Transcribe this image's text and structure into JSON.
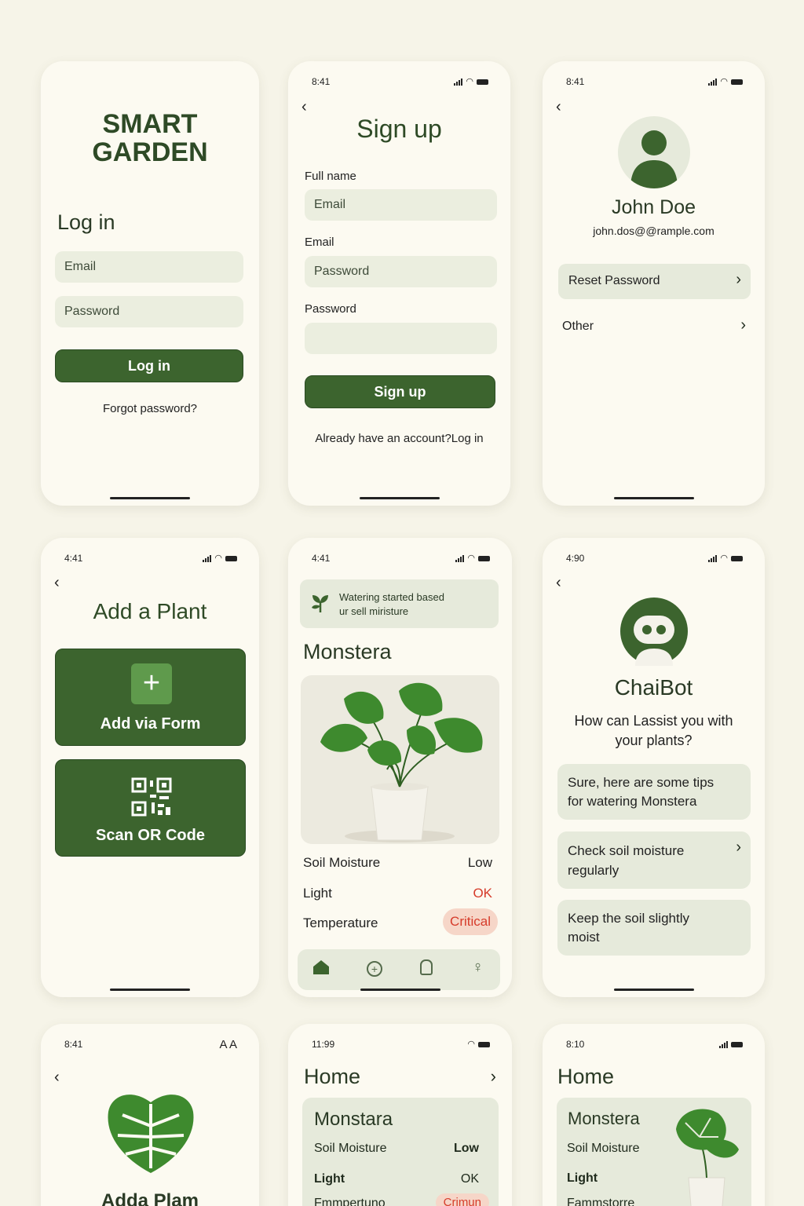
{
  "status_bar": {
    "time_1": "8:41",
    "time_2": "8:41",
    "time_3": "4:41",
    "time_4": "4:41",
    "time_5": "4:90",
    "time_6": "8:41",
    "time_7": "11:99",
    "time_8": "8:10",
    "text_size": "A A"
  },
  "login": {
    "brand_line1": "SMART",
    "brand_line2": "GARDEN",
    "title": "Log in",
    "email_placeholder": "Email",
    "password_placeholder": "Password",
    "button": "Log in",
    "forgot": "Forgot password?"
  },
  "signup": {
    "title": "Sign up",
    "full_name_label": "Full name",
    "full_name_placeholder": "Email",
    "email_label": "Email",
    "email_placeholder": "Password",
    "password_label": "Password",
    "password_placeholder": "",
    "button": "Sign up",
    "footer": "Already have an account?Log in"
  },
  "profile": {
    "name": "John Doe",
    "email": "john.dos@@rample.com",
    "items": [
      {
        "label": "Reset Password"
      },
      {
        "label": "Other"
      }
    ]
  },
  "add_plant": {
    "title": "Add a Plant",
    "form_button": "Add via Form",
    "qr_button": "Scan OR Code"
  },
  "plant_detail": {
    "banner_line1": "Watering started based",
    "banner_line2": "ur sell miristure",
    "plant_name": "Monstera",
    "rows": [
      {
        "label": "Soil Moisture",
        "value": "Low"
      },
      {
        "label": "Light",
        "value": "OK"
      },
      {
        "label": "Temperature",
        "value": "Critical"
      }
    ]
  },
  "chatbot": {
    "name": "ChaiBot",
    "question_line1": "How can Lassist you with",
    "question_line2": "your plants?",
    "messages": [
      {
        "line1": "Sure, here are some tips",
        "line2": "for watering Monstera"
      },
      {
        "line1": "Check soil moisture",
        "line2": "regularly"
      },
      {
        "line1": "Keep the soil slightly",
        "line2": "moist"
      }
    ]
  },
  "add_plant_2": {
    "title": "Adda Plam"
  },
  "home_1": {
    "title": "Home",
    "card_title": "Monstara",
    "rows": [
      {
        "label": "Soil Moisture",
        "value": "Low"
      },
      {
        "label": "Light",
        "value": "OK"
      },
      {
        "label": "Fmmpertuno",
        "value": "Crimun"
      }
    ]
  },
  "home_2": {
    "title": "Home",
    "card_title": "Monstera",
    "rows": [
      {
        "label": "Soil Moisture"
      },
      {
        "label": "Light"
      },
      {
        "label": "Fammstorre"
      }
    ]
  },
  "colors": {
    "primary": "#3c642e",
    "accent_red": "#d63b2a",
    "critical_bg": "#f6d6c8",
    "card_bg": "#e6eadb",
    "page_bg": "#f6f4e8"
  }
}
